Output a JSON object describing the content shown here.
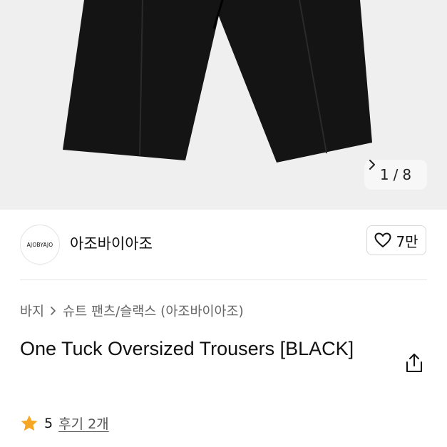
{
  "gallery": {
    "current": "1",
    "separator": "/",
    "total": "8",
    "background": "#efefef",
    "garment_color": "#141414"
  },
  "seller": {
    "logo_text": "AJOBYAJO",
    "name": "아조바이아조",
    "likes": "7만"
  },
  "breadcrumb": {
    "category": "바지",
    "subcategory": "슈트 팬츠/슬랙스 (아조바이아조)"
  },
  "product": {
    "title": "One Tuck Oversized Trousers [BLACK]"
  },
  "rating": {
    "score": "5",
    "reviews": "후기 2개",
    "star_color": "#f5a623"
  }
}
